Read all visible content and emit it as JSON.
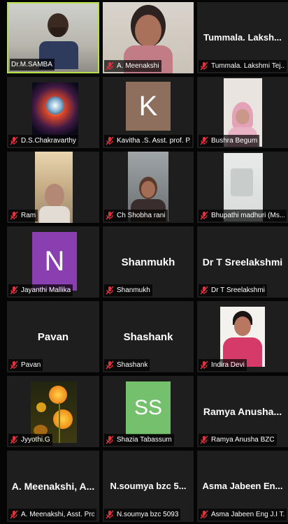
{
  "participants": [
    {
      "caption": "Dr.M.SAMBA",
      "muted": false,
      "kind": "video"
    },
    {
      "caption": "A. Meenakshi",
      "muted": true,
      "kind": "video"
    },
    {
      "caption": "Tummala. Lakshmi Tej...",
      "muted": true,
      "kind": "name",
      "display_name": "Tummala. Laksh..."
    },
    {
      "caption": "D.S.Chakravarthy",
      "muted": true,
      "kind": "image"
    },
    {
      "caption": "Kavitha .S. Asst. prof. P...",
      "muted": true,
      "kind": "letter",
      "letter": "K",
      "color": "#8e6f5e"
    },
    {
      "caption": "Bushra Begum",
      "muted": true,
      "kind": "video"
    },
    {
      "caption": "Ram",
      "muted": true,
      "kind": "video"
    },
    {
      "caption": "Ch Shobha rani",
      "muted": true,
      "kind": "video"
    },
    {
      "caption": "Bhupathi madhuri (Ms...",
      "muted": true,
      "kind": "video"
    },
    {
      "caption": "Jayanthi Mallika",
      "muted": true,
      "kind": "letter",
      "letter": "N",
      "color": "#8a3fb0"
    },
    {
      "caption": "Shanmukh",
      "muted": true,
      "kind": "name",
      "display_name": "Shanmukh"
    },
    {
      "caption": "Dr T Sreelakshmi",
      "muted": true,
      "kind": "name",
      "display_name": "Dr T Sreelakshmi"
    },
    {
      "caption": "Pavan",
      "muted": true,
      "kind": "name",
      "display_name": "Pavan"
    },
    {
      "caption": "Shashank",
      "muted": true,
      "kind": "name",
      "display_name": "Shashank"
    },
    {
      "caption": "Indira Devi",
      "muted": true,
      "kind": "image"
    },
    {
      "caption": "Jyyothi.G",
      "muted": true,
      "kind": "image"
    },
    {
      "caption": "Shazia Tabassum",
      "muted": true,
      "kind": "letter",
      "letter": "SS",
      "color": "#74c06d"
    },
    {
      "caption": "Ramya Anusha  BZC",
      "muted": true,
      "kind": "name",
      "display_name": "Ramya  Anusha..."
    },
    {
      "caption": "A. Meenakshi, Asst. Pro...",
      "muted": true,
      "kind": "name",
      "display_name": "A. Meenakshi, A..."
    },
    {
      "caption": "N.soumya bzc 5093",
      "muted": true,
      "kind": "name",
      "display_name": "N.soumya bzc 5..."
    },
    {
      "caption": "Asma Jabeen Eng J.I T...",
      "muted": true,
      "kind": "name",
      "display_name": "Asma Jabeen En..."
    }
  ],
  "colors": {
    "tile_bg": "#1e1e1e",
    "active_border": "#b6e04a",
    "muted_mic": "#e0333c"
  }
}
